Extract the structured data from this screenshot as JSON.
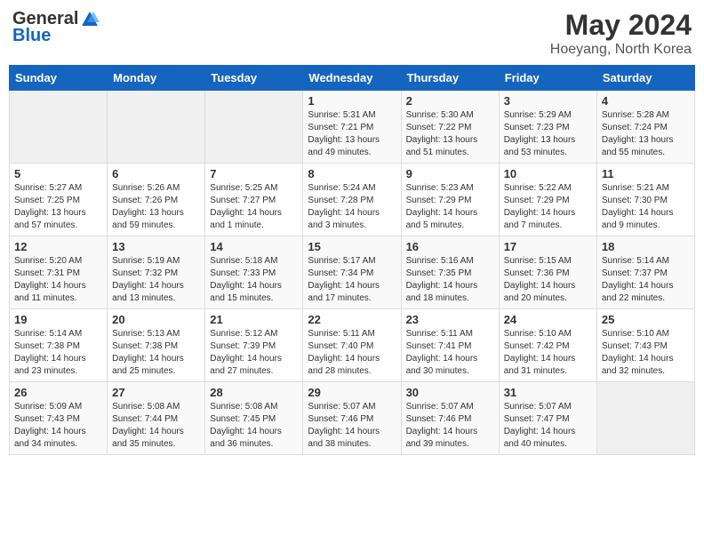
{
  "logo": {
    "general": "General",
    "blue": "Blue"
  },
  "title": "May 2024",
  "subtitle": "Hoeyang, North Korea",
  "days_of_week": [
    "Sunday",
    "Monday",
    "Tuesday",
    "Wednesday",
    "Thursday",
    "Friday",
    "Saturday"
  ],
  "weeks": [
    [
      {
        "day": "",
        "empty": true
      },
      {
        "day": "",
        "empty": true
      },
      {
        "day": "",
        "empty": true
      },
      {
        "day": "1",
        "sunrise": "Sunrise: 5:31 AM",
        "sunset": "Sunset: 7:21 PM",
        "daylight": "Daylight: 13 hours and 49 minutes."
      },
      {
        "day": "2",
        "sunrise": "Sunrise: 5:30 AM",
        "sunset": "Sunset: 7:22 PM",
        "daylight": "Daylight: 13 hours and 51 minutes."
      },
      {
        "day": "3",
        "sunrise": "Sunrise: 5:29 AM",
        "sunset": "Sunset: 7:23 PM",
        "daylight": "Daylight: 13 hours and 53 minutes."
      },
      {
        "day": "4",
        "sunrise": "Sunrise: 5:28 AM",
        "sunset": "Sunset: 7:24 PM",
        "daylight": "Daylight: 13 hours and 55 minutes."
      }
    ],
    [
      {
        "day": "5",
        "sunrise": "Sunrise: 5:27 AM",
        "sunset": "Sunset: 7:25 PM",
        "daylight": "Daylight: 13 hours and 57 minutes."
      },
      {
        "day": "6",
        "sunrise": "Sunrise: 5:26 AM",
        "sunset": "Sunset: 7:26 PM",
        "daylight": "Daylight: 13 hours and 59 minutes."
      },
      {
        "day": "7",
        "sunrise": "Sunrise: 5:25 AM",
        "sunset": "Sunset: 7:27 PM",
        "daylight": "Daylight: 14 hours and 1 minute."
      },
      {
        "day": "8",
        "sunrise": "Sunrise: 5:24 AM",
        "sunset": "Sunset: 7:28 PM",
        "daylight": "Daylight: 14 hours and 3 minutes."
      },
      {
        "day": "9",
        "sunrise": "Sunrise: 5:23 AM",
        "sunset": "Sunset: 7:29 PM",
        "daylight": "Daylight: 14 hours and 5 minutes."
      },
      {
        "day": "10",
        "sunrise": "Sunrise: 5:22 AM",
        "sunset": "Sunset: 7:29 PM",
        "daylight": "Daylight: 14 hours and 7 minutes."
      },
      {
        "day": "11",
        "sunrise": "Sunrise: 5:21 AM",
        "sunset": "Sunset: 7:30 PM",
        "daylight": "Daylight: 14 hours and 9 minutes."
      }
    ],
    [
      {
        "day": "12",
        "sunrise": "Sunrise: 5:20 AM",
        "sunset": "Sunset: 7:31 PM",
        "daylight": "Daylight: 14 hours and 11 minutes."
      },
      {
        "day": "13",
        "sunrise": "Sunrise: 5:19 AM",
        "sunset": "Sunset: 7:32 PM",
        "daylight": "Daylight: 14 hours and 13 minutes."
      },
      {
        "day": "14",
        "sunrise": "Sunrise: 5:18 AM",
        "sunset": "Sunset: 7:33 PM",
        "daylight": "Daylight: 14 hours and 15 minutes."
      },
      {
        "day": "15",
        "sunrise": "Sunrise: 5:17 AM",
        "sunset": "Sunset: 7:34 PM",
        "daylight": "Daylight: 14 hours and 17 minutes."
      },
      {
        "day": "16",
        "sunrise": "Sunrise: 5:16 AM",
        "sunset": "Sunset: 7:35 PM",
        "daylight": "Daylight: 14 hours and 18 minutes."
      },
      {
        "day": "17",
        "sunrise": "Sunrise: 5:15 AM",
        "sunset": "Sunset: 7:36 PM",
        "daylight": "Daylight: 14 hours and 20 minutes."
      },
      {
        "day": "18",
        "sunrise": "Sunrise: 5:14 AM",
        "sunset": "Sunset: 7:37 PM",
        "daylight": "Daylight: 14 hours and 22 minutes."
      }
    ],
    [
      {
        "day": "19",
        "sunrise": "Sunrise: 5:14 AM",
        "sunset": "Sunset: 7:38 PM",
        "daylight": "Daylight: 14 hours and 23 minutes."
      },
      {
        "day": "20",
        "sunrise": "Sunrise: 5:13 AM",
        "sunset": "Sunset: 7:38 PM",
        "daylight": "Daylight: 14 hours and 25 minutes."
      },
      {
        "day": "21",
        "sunrise": "Sunrise: 5:12 AM",
        "sunset": "Sunset: 7:39 PM",
        "daylight": "Daylight: 14 hours and 27 minutes."
      },
      {
        "day": "22",
        "sunrise": "Sunrise: 5:11 AM",
        "sunset": "Sunset: 7:40 PM",
        "daylight": "Daylight: 14 hours and 28 minutes."
      },
      {
        "day": "23",
        "sunrise": "Sunrise: 5:11 AM",
        "sunset": "Sunset: 7:41 PM",
        "daylight": "Daylight: 14 hours and 30 minutes."
      },
      {
        "day": "24",
        "sunrise": "Sunrise: 5:10 AM",
        "sunset": "Sunset: 7:42 PM",
        "daylight": "Daylight: 14 hours and 31 minutes."
      },
      {
        "day": "25",
        "sunrise": "Sunrise: 5:10 AM",
        "sunset": "Sunset: 7:43 PM",
        "daylight": "Daylight: 14 hours and 32 minutes."
      }
    ],
    [
      {
        "day": "26",
        "sunrise": "Sunrise: 5:09 AM",
        "sunset": "Sunset: 7:43 PM",
        "daylight": "Daylight: 14 hours and 34 minutes."
      },
      {
        "day": "27",
        "sunrise": "Sunrise: 5:08 AM",
        "sunset": "Sunset: 7:44 PM",
        "daylight": "Daylight: 14 hours and 35 minutes."
      },
      {
        "day": "28",
        "sunrise": "Sunrise: 5:08 AM",
        "sunset": "Sunset: 7:45 PM",
        "daylight": "Daylight: 14 hours and 36 minutes."
      },
      {
        "day": "29",
        "sunrise": "Sunrise: 5:07 AM",
        "sunset": "Sunset: 7:46 PM",
        "daylight": "Daylight: 14 hours and 38 minutes."
      },
      {
        "day": "30",
        "sunrise": "Sunrise: 5:07 AM",
        "sunset": "Sunset: 7:46 PM",
        "daylight": "Daylight: 14 hours and 39 minutes."
      },
      {
        "day": "31",
        "sunrise": "Sunrise: 5:07 AM",
        "sunset": "Sunset: 7:47 PM",
        "daylight": "Daylight: 14 hours and 40 minutes."
      },
      {
        "day": "",
        "empty": true
      }
    ]
  ]
}
